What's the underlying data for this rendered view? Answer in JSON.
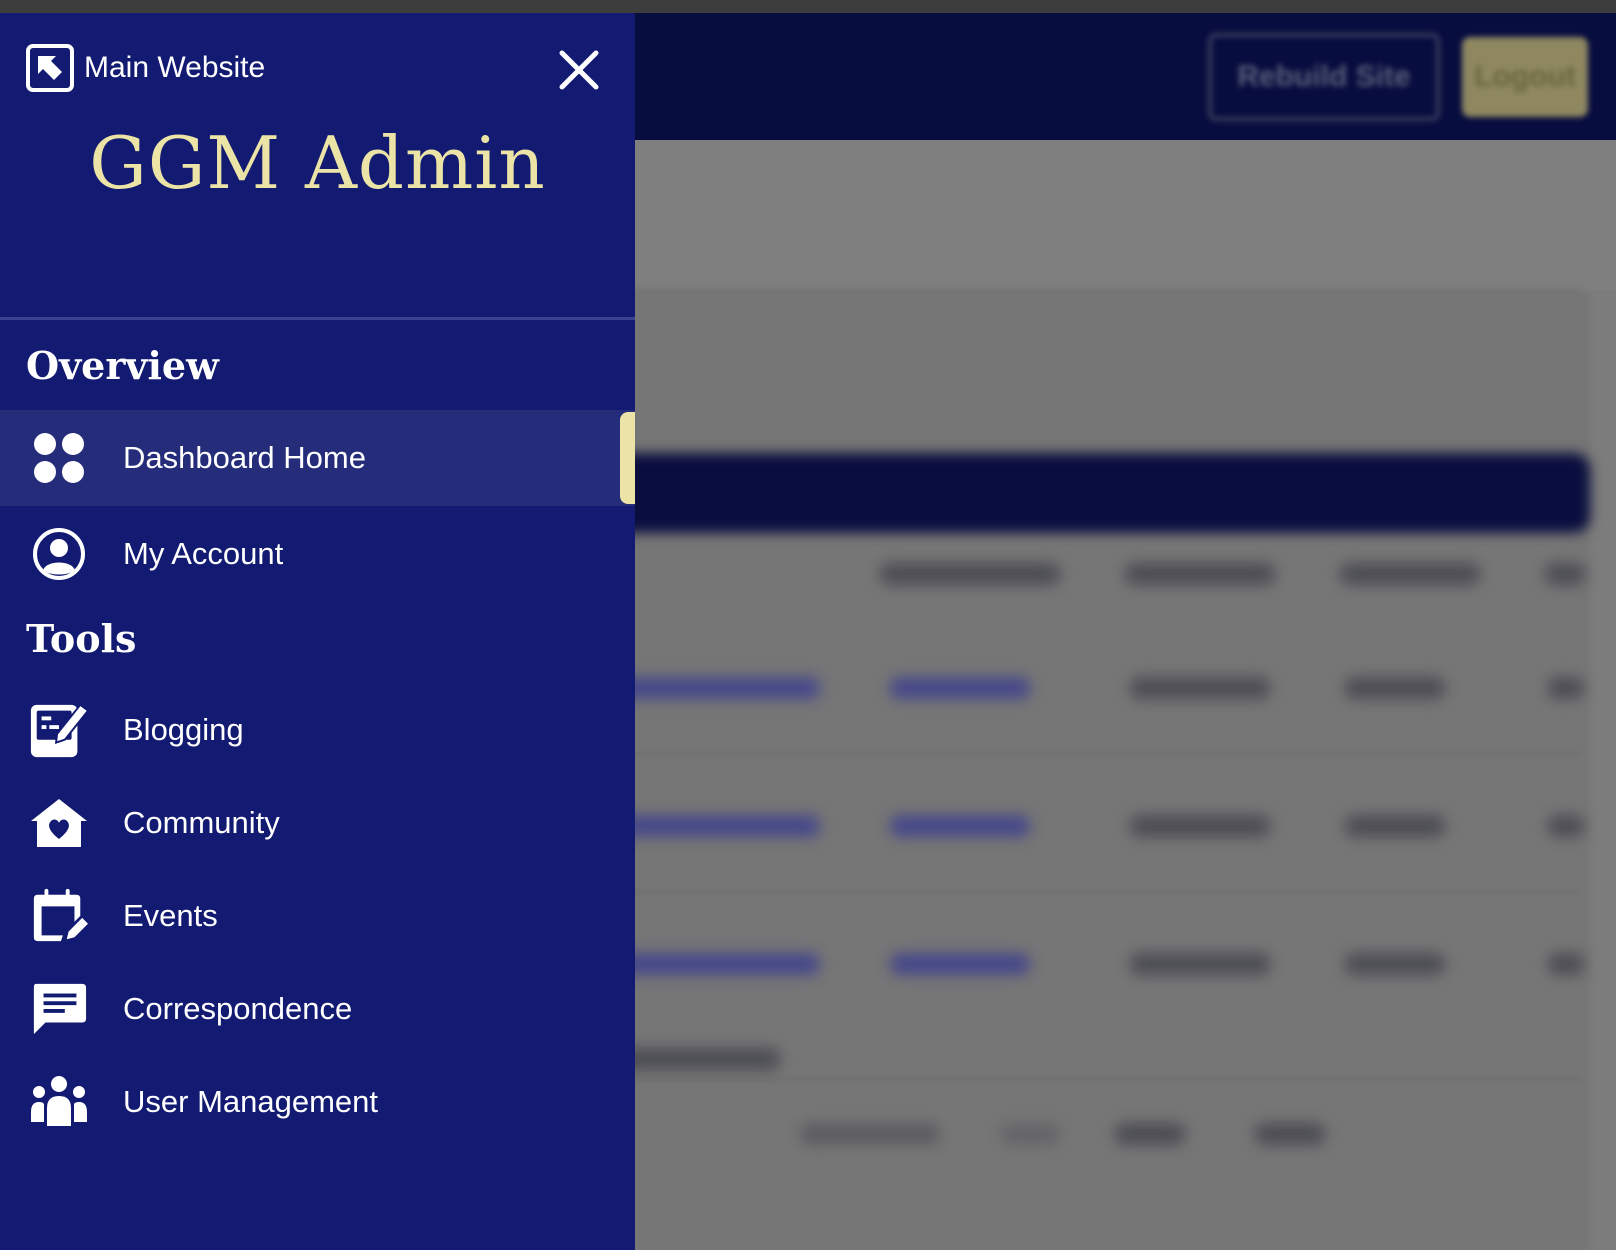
{
  "sidebar": {
    "main_link_label": "Main Website",
    "close_label": "Close menu",
    "brand_title": "GGM Admin",
    "sections": [
      {
        "heading": "Overview",
        "items": [
          {
            "label": "Dashboard Home",
            "icon": "grid-icon",
            "active": true
          },
          {
            "label": "My Account",
            "icon": "user-circle-icon",
            "active": false
          }
        ]
      },
      {
        "heading": "Tools",
        "items": [
          {
            "label": "Blogging",
            "icon": "edit-note-icon",
            "active": false
          },
          {
            "label": "Community",
            "icon": "house-heart-icon",
            "active": false
          },
          {
            "label": "Events",
            "icon": "calendar-edit-icon",
            "active": false
          },
          {
            "label": "Correspondence",
            "icon": "chat-bubble-icon",
            "active": false
          },
          {
            "label": "User Management",
            "icon": "people-group-icon",
            "active": false
          }
        ]
      }
    ]
  },
  "background": {
    "rebuild_label": "Rebuild Site",
    "logout_label": "Logout"
  },
  "colors": {
    "sidebar_bg": "#121a72",
    "active_item_bg": "#252d7a",
    "accent_gold": "#ece4a6",
    "header_dark": "#080d3f",
    "overlay_gray": "#7c7c7c"
  }
}
